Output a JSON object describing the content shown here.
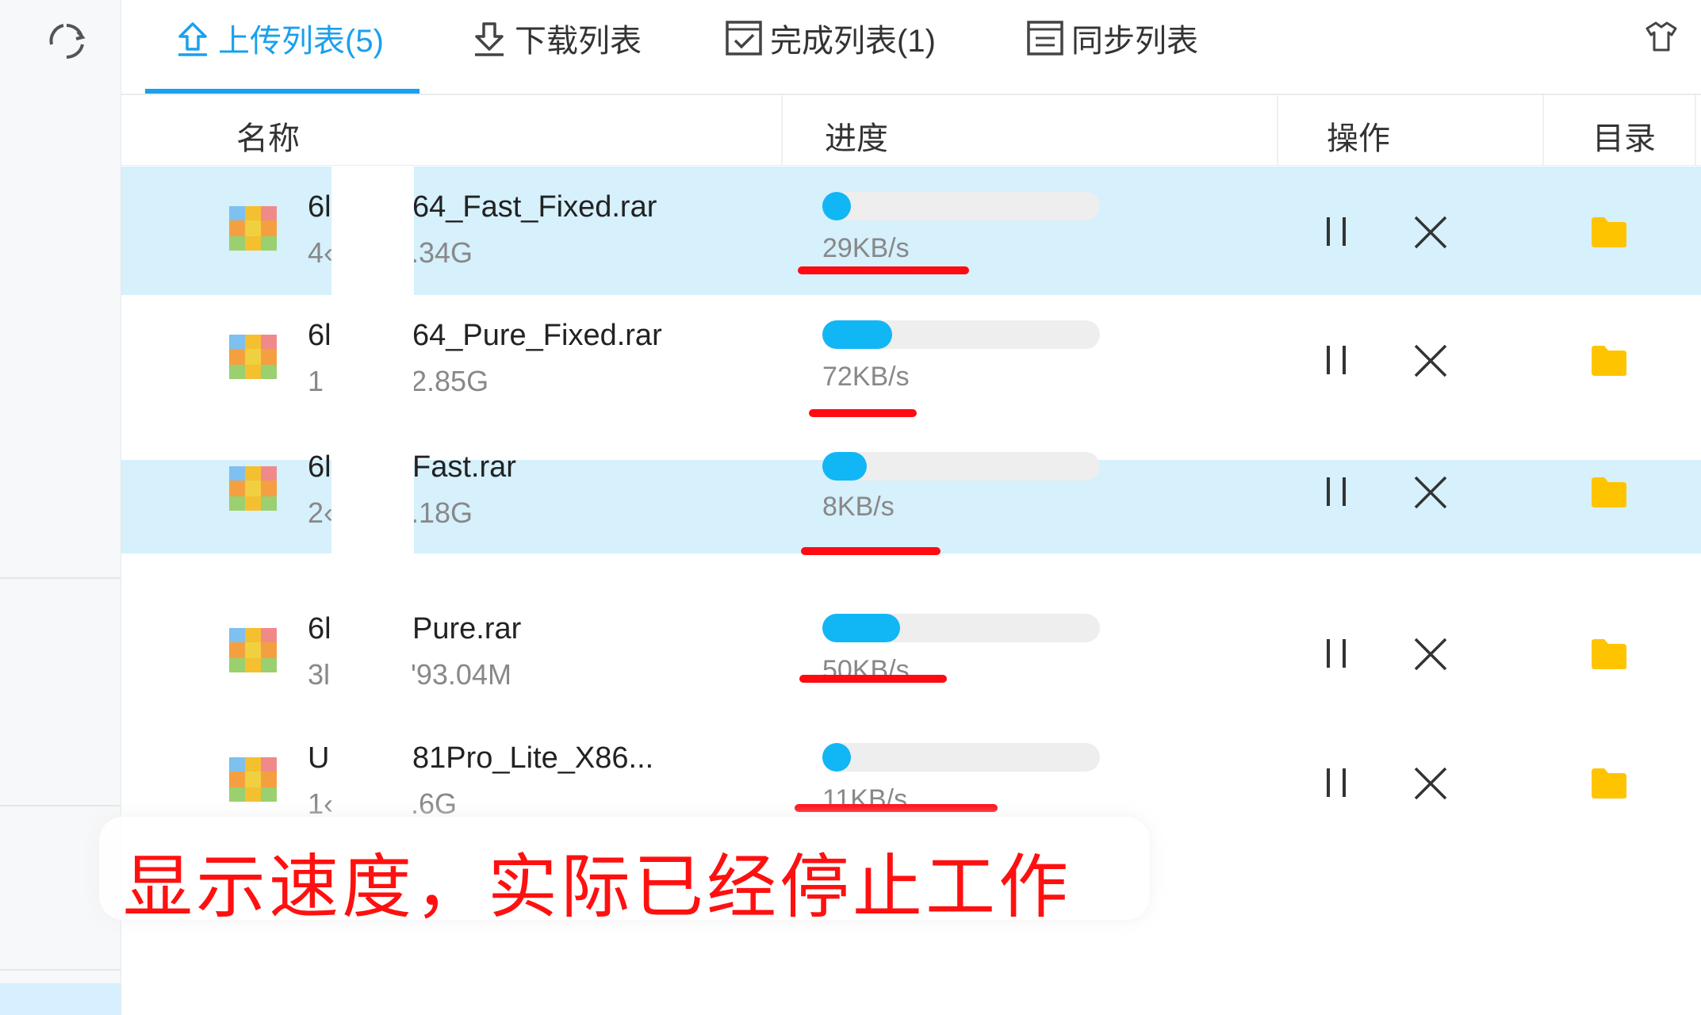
{
  "tabs": [
    {
      "label": "上传列表(5)",
      "active": true,
      "icon": "upload-icon"
    },
    {
      "label": "下载列表",
      "active": false,
      "icon": "download-icon"
    },
    {
      "label": "完成列表(1)",
      "active": false,
      "icon": "checkbox-icon"
    },
    {
      "label": "同步列表",
      "active": false,
      "icon": "sync-list-icon"
    }
  ],
  "columns": {
    "name": "名称",
    "progress": "进度",
    "action": "操作",
    "dir": "目录"
  },
  "rows": [
    {
      "name_a": "6l",
      "name_b": "64_Fast_Fixed.rar",
      "size_a": "4‹",
      "size_b": ".34G",
      "progress": 0.06,
      "speed": "29KB/s",
      "highlight": true
    },
    {
      "name_a": "6l",
      "name_b": "64_Pure_Fixed.rar",
      "size_a": "1",
      "size_b": "2.85G",
      "progress": 0.25,
      "speed": "72KB/s",
      "highlight": false
    },
    {
      "name_a": "6l",
      "name_b": "Fast.rar",
      "size_a": "2‹",
      "size_b": ".18G",
      "progress": 0.16,
      "speed": "8KB/s",
      "highlight": true
    },
    {
      "name_a": "6l",
      "name_b": "Pure.rar",
      "size_a": "3l",
      "size_b": "'93.04M",
      "progress": 0.28,
      "speed": "50KB/s",
      "highlight": false
    },
    {
      "name_a": "U",
      "name_b": "81Pro_Lite_X86...",
      "size_a": "1‹",
      "size_b": ".6G",
      "progress": 0.05,
      "speed": "11KB/s",
      "highlight": false
    }
  ],
  "annotation": "显示速度，实际已经停止工作",
  "colors": {
    "accent": "#1aa0ee",
    "progress": "#11b6f5",
    "highlight_row": "#d6f0fc",
    "annotation": "#ff1010",
    "folder": "#ffc400"
  }
}
